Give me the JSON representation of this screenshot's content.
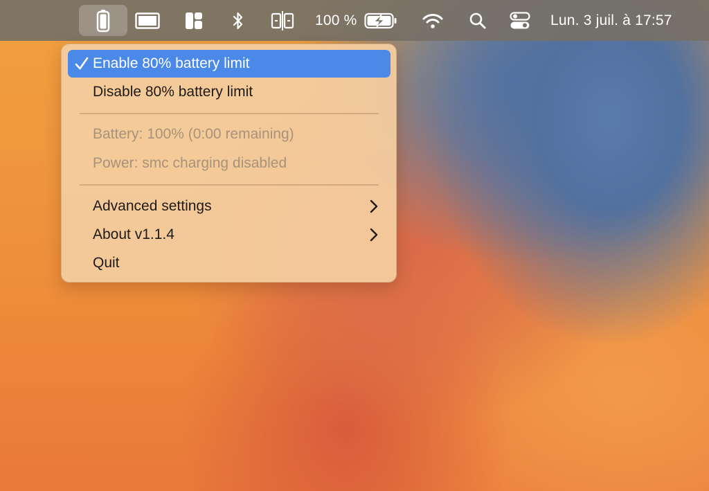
{
  "menubar": {
    "battery_percent_label": "100 %",
    "datetime": "Lun. 3 juil. à 17:57",
    "icons": [
      "phone-battery-app-icon",
      "display-icon",
      "window-layout-icon",
      "bluetooth-icon",
      "display-mirroring-icon",
      "battery-charging-icon",
      "wifi-icon",
      "spotlight-search-icon",
      "control-center-icon"
    ]
  },
  "menu": {
    "enable_label": "Enable 80% battery limit",
    "disable_label": "Disable 80% battery limit",
    "battery_status": "Battery: 100% (0:00 remaining)",
    "power_status": "Power: smc charging disabled",
    "advanced_label": "Advanced settings",
    "about_label": "About v1.1.4",
    "quit_label": "Quit"
  },
  "colors": {
    "highlight": "#4a89e8",
    "menu_background": "#f4cea0",
    "menubar_background": "#767066",
    "disabled_text": "#a8927a"
  }
}
